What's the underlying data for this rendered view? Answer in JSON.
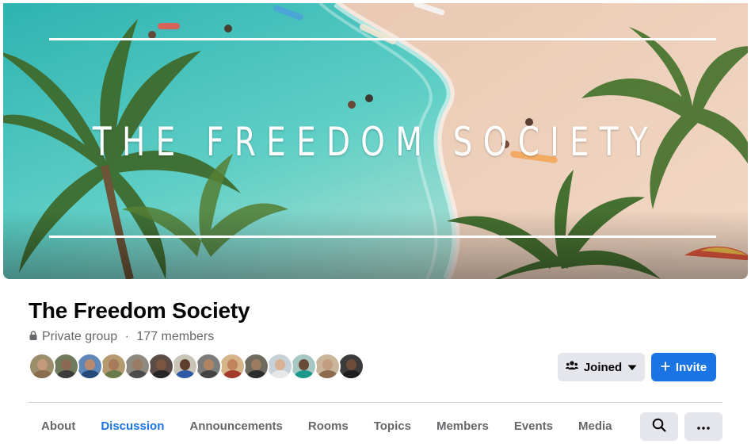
{
  "cover": {
    "title": "THE FREEDOM SOCIETY",
    "scene": "aerial beach with turquoise water, surfers and palm trees"
  },
  "group": {
    "name": "The Freedom Society",
    "privacy": "Private group",
    "separator": " · ",
    "members": "177 members"
  },
  "member_avatars": [
    {
      "name": "member-1",
      "skin": "#c59a7a",
      "shirt": "#8a6d4f",
      "bg": "#9c8e6a"
    },
    {
      "name": "member-2",
      "skin": "#8a6a52",
      "shirt": "#3b3b3b",
      "bg": "#6f7b5c"
    },
    {
      "name": "member-3",
      "skin": "#b98a6e",
      "shirt": "#244a7a",
      "bg": "#5f87b8"
    },
    {
      "name": "member-4",
      "skin": "#a67a5b",
      "shirt": "#6a7b4a",
      "bg": "#b49a6e"
    },
    {
      "name": "member-5",
      "skin": "#9a7b64",
      "shirt": "#4c4c4c",
      "bg": "#8e8a82"
    },
    {
      "name": "member-6",
      "skin": "#7a5540",
      "shirt": "#262626",
      "bg": "#5b4d45"
    },
    {
      "name": "member-7",
      "skin": "#5e3e2c",
      "shirt": "#2f5aa8",
      "bg": "#c9c4b8"
    },
    {
      "name": "member-8",
      "skin": "#b08462",
      "shirt": "#444444",
      "bg": "#7c7c7c"
    },
    {
      "name": "member-9",
      "skin": "#c2845c",
      "shirt": "#a33a2b",
      "bg": "#d6b48a"
    },
    {
      "name": "member-10",
      "skin": "#9b7a60",
      "shirt": "#2c2c2c",
      "bg": "#6e6a5e"
    },
    {
      "name": "member-11",
      "skin": "#d8b196",
      "shirt": "#e8e8e8",
      "bg": "#c7d1d8"
    },
    {
      "name": "member-12",
      "skin": "#6b4a38",
      "shirt": "#1a9a8c",
      "bg": "#a7c8c2"
    },
    {
      "name": "member-13",
      "skin": "#c29c80",
      "shirt": "#8c6a4e",
      "bg": "#c9b59a"
    },
    {
      "name": "member-14",
      "skin": "#6e4c3a",
      "shirt": "#1e1e1e",
      "bg": "#3b3b3b"
    }
  ],
  "actions": {
    "joined_label": "Joined",
    "joined_icon": "people-icon",
    "joined_caret": "caret-down-icon",
    "invite_label": "Invite",
    "invite_icon": "plus-icon"
  },
  "tabs": [
    {
      "label": "About",
      "active": false
    },
    {
      "label": "Discussion",
      "active": true
    },
    {
      "label": "Announcements",
      "active": false
    },
    {
      "label": "Rooms",
      "active": false
    },
    {
      "label": "Topics",
      "active": false
    },
    {
      "label": "Members",
      "active": false
    },
    {
      "label": "Events",
      "active": false
    },
    {
      "label": "Media",
      "active": false
    }
  ],
  "toolbar": {
    "search_icon": "search-icon",
    "more_icon": "more-horizontal-icon"
  },
  "colors": {
    "accent": "#1b74e4",
    "secondary_text": "#65676b",
    "button_gray": "#e4e6eb",
    "divider": "#ced0d4"
  }
}
